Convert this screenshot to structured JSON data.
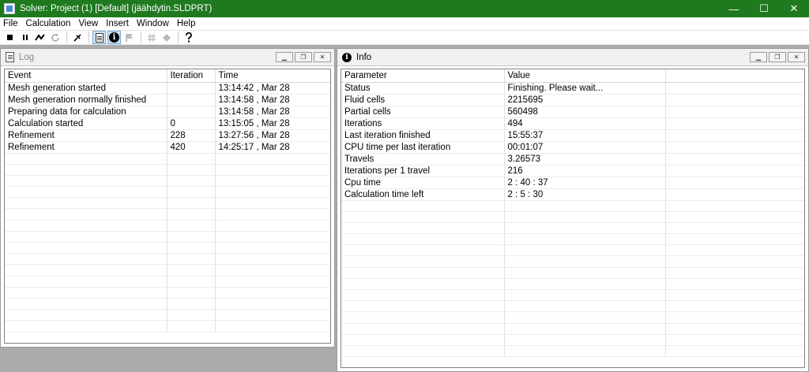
{
  "window": {
    "title": "Solver: Project (1) [Default] (jäähdytin.SLDPRT)",
    "btn_min": "—",
    "btn_max": "☐",
    "btn_close": "✕"
  },
  "menu": [
    "File",
    "Calculation",
    "View",
    "Insert",
    "Window",
    "Help"
  ],
  "toolbar": {
    "stop_icon": "stop-icon",
    "pause_icon": "pause-icon",
    "insert_icon": "insert-icon",
    "refresh_icon": "refresh-icon",
    "pin_icon": "pin-icon",
    "log_icon": "log-icon",
    "info_icon": "info-icon",
    "flag_icon": "flag-icon",
    "grid_icon": "grid-icon",
    "diamond_icon": "diamond-icon",
    "help_icon": "help-icon"
  },
  "log": {
    "title": "Log",
    "columns": [
      "Event",
      "Iteration",
      "Time"
    ],
    "rows": [
      [
        "Mesh generation started",
        "",
        "13:14:42 , Mar 28"
      ],
      [
        "Mesh generation normally finished",
        "",
        "13:14:58 , Mar 28"
      ],
      [
        "Preparing data for calculation",
        "",
        "13:14:58 , Mar 28"
      ],
      [
        "Calculation started",
        "0",
        "13:15:05 , Mar 28"
      ],
      [
        "Refinement",
        "228",
        "13:27:56 , Mar 28"
      ],
      [
        "Refinement",
        "420",
        "14:25:17 , Mar 28"
      ]
    ],
    "empty_rows": 16
  },
  "info": {
    "title": "Info",
    "columns": [
      "Parameter",
      "Value",
      ""
    ],
    "rows": [
      [
        "Status",
        "Finishing. Please wait...",
        ""
      ],
      [
        "Fluid cells",
        "2215695",
        ""
      ],
      [
        "Partial cells",
        "560498",
        ""
      ],
      [
        "Iterations",
        "494",
        ""
      ],
      [
        "Last iteration finished",
        "15:55:37",
        ""
      ],
      [
        "CPU time per last iteration",
        "00:01:07",
        ""
      ],
      [
        "Travels",
        "3.26573",
        ""
      ],
      [
        "Iterations per 1 travel",
        "216",
        ""
      ],
      [
        "Cpu time",
        "2 : 40 : 37",
        ""
      ],
      [
        "Calculation time left",
        "2 : 5 : 30",
        ""
      ]
    ],
    "empty_rows": 14
  },
  "colors": {
    "titlebar": "#1f7a1f",
    "workspace": "#ababab"
  }
}
